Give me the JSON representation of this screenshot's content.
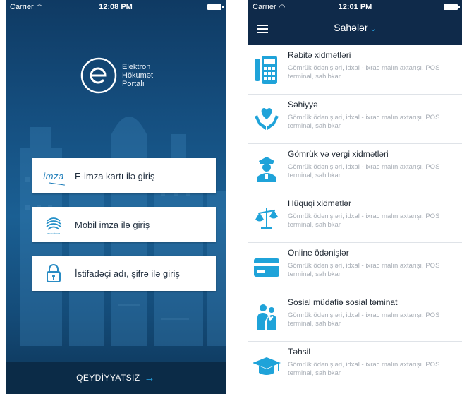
{
  "left_phone": {
    "status": {
      "carrier": "Carrier",
      "time": "12:08 PM"
    },
    "brand": {
      "line1": "Elektron",
      "line2": "Hökumət",
      "line3": "Portalı"
    },
    "buttons": [
      {
        "icon_text": "imza",
        "label": "E-imza kartı ilə giriş"
      },
      {
        "icon_text": "asan imza",
        "label": "Mobil imza ilə giriş"
      },
      {
        "label": "İstifadəçi adı, şifrə ilə giriş"
      }
    ],
    "footer": {
      "label": "QEYDİYYATSIZ",
      "arrow": "→"
    }
  },
  "right_phone": {
    "status": {
      "carrier": "Carrier",
      "time": "12:01 PM"
    },
    "nav": {
      "title": "Sahələr",
      "chevron": "⌄"
    },
    "items": [
      {
        "icon": "calculator-phone-icon",
        "title": "Rabitə xidmətləri",
        "subtitle": "Gömrük ödənişləri, idxal - ixrac malın axtarışı, POS terminal, sahibkar"
      },
      {
        "icon": "heart-hands-icon",
        "title": "Səhiyyə",
        "subtitle": "Gömrük ödənişləri, idxal - ixrac malın axtarışı, POS terminal, sahibkar"
      },
      {
        "icon": "officer-icon",
        "title": "Gömrük və vergi xidmətləri",
        "subtitle": "Gömrük ödənişləri, idxal - ixrac malın axtarışı, POS terminal, sahibkar"
      },
      {
        "icon": "scales-icon",
        "title": "Hüquqi xidmətlər",
        "subtitle": "Gömrük ödənişləri, idxal - ixrac malın axtarışı, POS terminal, sahibkar"
      },
      {
        "icon": "credit-card-icon",
        "title": "Online ödənişlər",
        "subtitle": "Gömrük ödənişləri, idxal - ixrac malın axtarışı, POS terminal, sahibkar"
      },
      {
        "icon": "family-icon",
        "title": "Sosial müdafiə sosial təminat",
        "subtitle": "Gömrük ödənişləri, idxal - ixrac malın axtarışı, POS terminal, sahibkar"
      },
      {
        "icon": "graduation-cap-icon",
        "title": "Təhsil",
        "subtitle": "Gömrük ödənişləri, idxal - ixrac malın axtarışı, POS terminal, sahibkar"
      }
    ]
  },
  "colors": {
    "navy": "#0f2a4a",
    "accent": "#1fa3d9",
    "login_bg": "#154f80"
  }
}
